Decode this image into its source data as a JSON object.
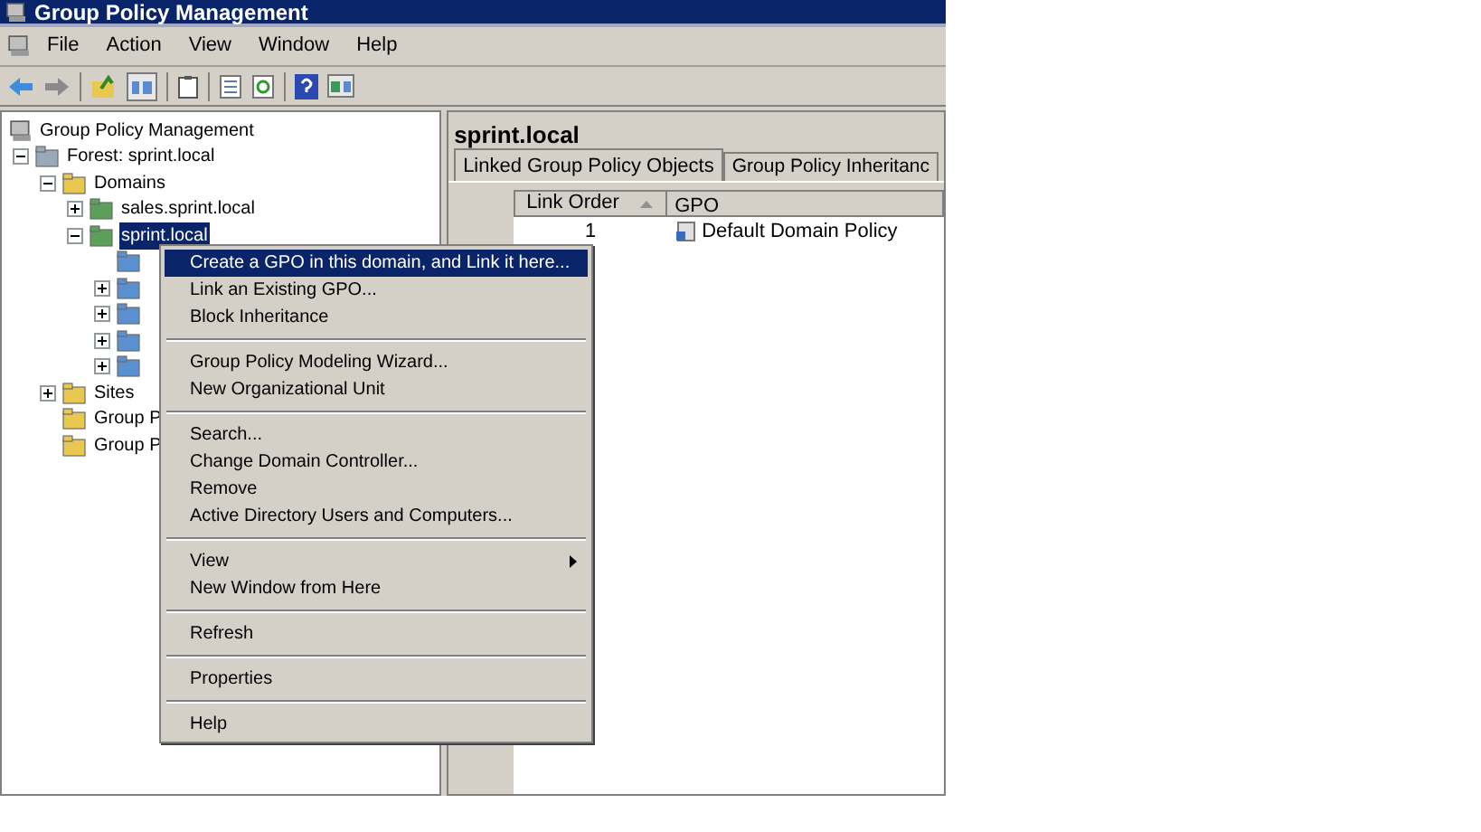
{
  "window": {
    "title": "Group Policy Management"
  },
  "menu_bar": [
    "File",
    "Action",
    "View",
    "Window",
    "Help"
  ],
  "tree": {
    "label": "Group Policy Management",
    "children": [
      {
        "label": "Forest: sprint.local",
        "expanded": true,
        "children": [
          {
            "label": "Domains",
            "expanded": true,
            "children": [
              {
                "label": "sales.sprint.local",
                "expanded": false
              },
              {
                "label": "sprint.local",
                "expanded": true,
                "selected": true,
                "children": [
                  {
                    "expandable": false
                  },
                  {
                    "expandable": true
                  },
                  {
                    "expandable": true
                  },
                  {
                    "expandable": true
                  },
                  {
                    "expandable": true
                  }
                ]
              }
            ]
          },
          {
            "label": "Sites",
            "expanded": false
          },
          {
            "label": "Group P"
          },
          {
            "label": "Group P"
          }
        ]
      }
    ]
  },
  "details": {
    "title": "sprint.local",
    "tabs": [
      {
        "label": "Linked Group Policy Objects",
        "selected": true
      },
      {
        "label": "Group Policy Inheritanc",
        "selected": false
      }
    ],
    "columns": [
      "Link Order",
      "GPO"
    ],
    "rows": [
      {
        "link_order": "1",
        "gpo": "Default Domain Policy"
      }
    ]
  },
  "context_menu": [
    {
      "kind": "item",
      "label": "Create a GPO in this domain, and Link it here...",
      "selected": true
    },
    {
      "kind": "item",
      "label": "Link an Existing GPO...",
      "selected": false
    },
    {
      "kind": "item",
      "label": "Block Inheritance",
      "selected": false
    },
    {
      "kind": "separator"
    },
    {
      "kind": "item",
      "label": "Group Policy Modeling Wizard...",
      "selected": false
    },
    {
      "kind": "item",
      "label": "New Organizational Unit",
      "selected": false
    },
    {
      "kind": "separator"
    },
    {
      "kind": "item",
      "label": "Search...",
      "selected": false
    },
    {
      "kind": "item",
      "label": "Change Domain Controller...",
      "selected": false
    },
    {
      "kind": "item",
      "label": "Remove",
      "selected": false
    },
    {
      "kind": "item",
      "label": "Active Directory Users and Computers...",
      "selected": false
    },
    {
      "kind": "separator"
    },
    {
      "kind": "submenu",
      "label": "View",
      "selected": false
    },
    {
      "kind": "item",
      "label": "New Window from Here",
      "selected": false
    },
    {
      "kind": "separator"
    },
    {
      "kind": "item",
      "label": "Refresh",
      "selected": false
    },
    {
      "kind": "separator"
    },
    {
      "kind": "item",
      "label": "Properties",
      "selected": false
    },
    {
      "kind": "separator"
    },
    {
      "kind": "item",
      "label": "Help",
      "selected": false
    }
  ]
}
